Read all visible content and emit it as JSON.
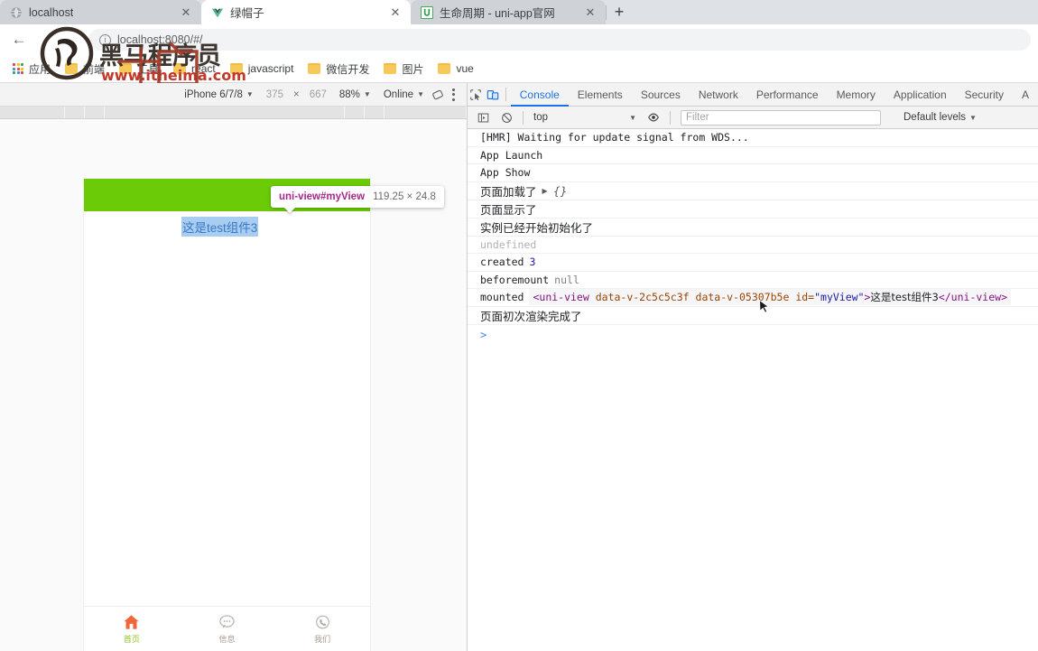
{
  "browser": {
    "tabs": [
      {
        "title": "localhost",
        "icon": "globe-icon",
        "active": false
      },
      {
        "title": "绿帽子",
        "icon": "vue-icon",
        "active": true
      },
      {
        "title": "生命周期 - uni-app官网",
        "icon": "uniapp-icon",
        "active": false
      }
    ],
    "new_tab_label": "+",
    "close_label": "✕",
    "back_label": "←",
    "address": {
      "url": "localhost:8080/#/",
      "info_icon": "page-info-icon",
      "info_glyph": "i"
    },
    "bookmarks": [
      {
        "label": "应用",
        "icon": "apps-grid-icon"
      },
      {
        "label": "前端",
        "icon": "folder-icon"
      },
      {
        "label": "工具",
        "icon": "folder-icon"
      },
      {
        "label": "react",
        "icon": "folder-icon"
      },
      {
        "label": "javascript",
        "icon": "folder-icon"
      },
      {
        "label": "微信开发",
        "icon": "folder-icon"
      },
      {
        "label": "图片",
        "icon": "folder-icon"
      },
      {
        "label": "vue",
        "icon": "folder-icon"
      }
    ],
    "watermark": {
      "title": "黑马程序员",
      "url": "www.itheima.com"
    }
  },
  "device_toolbar": {
    "device": "iPhone 6/7/8",
    "width": "375",
    "height": "667",
    "x_label": "×",
    "zoom": "88%",
    "throttling": "Online",
    "rotate_icon": "rotate-icon",
    "more_icon": "more-vertical-icon",
    "caret": "▼"
  },
  "viewport": {
    "highlight_badge": {
      "selector": "uni-view#myView",
      "size": "119.25 × 24.8"
    },
    "page_text": "这是test组件3",
    "green_bar_color": "#6bcb07",
    "tabbar": [
      {
        "label": "首页",
        "icon": "home-icon",
        "color": "#f1663a",
        "label_color": "#8ec31f"
      },
      {
        "label": "信息",
        "icon": "message-icon",
        "color": "#b4b0a9",
        "label_color": "#a89b8c"
      },
      {
        "label": "我们",
        "icon": "phone-icon",
        "color": "#b4b0a9",
        "label_color": "#a89b8c"
      }
    ]
  },
  "devtools": {
    "icons": {
      "inspect": "inspect-cursor-icon",
      "device": "device-toggle-icon",
      "sidebar": "console-sidebar-icon",
      "clear": "clear-console-icon",
      "eye": "live-expression-icon"
    },
    "panels": [
      {
        "label": "Console",
        "active": true
      },
      {
        "label": "Elements",
        "active": false
      },
      {
        "label": "Sources",
        "active": false
      },
      {
        "label": "Network",
        "active": false
      },
      {
        "label": "Performance",
        "active": false
      },
      {
        "label": "Memory",
        "active": false
      },
      {
        "label": "Application",
        "active": false
      },
      {
        "label": "Security",
        "active": false
      },
      {
        "label": "A",
        "active": false
      }
    ],
    "filterbar": {
      "context": "top",
      "filter_placeholder": "Filter",
      "levels": "Default levels",
      "caret": "▼"
    },
    "console_rows": [
      {
        "type": "plain",
        "text": "[HMR] Waiting for update signal from WDS..."
      },
      {
        "type": "plain",
        "text": "App Launch"
      },
      {
        "type": "plain",
        "text": "App Show"
      },
      {
        "type": "object",
        "text": "页面加载了",
        "arrow": "▶",
        "object": "{}"
      },
      {
        "type": "cjk",
        "text": "页面显示了"
      },
      {
        "type": "cjk",
        "text": "实例已经开始初始化了"
      },
      {
        "type": "muted",
        "text": "undefined"
      },
      {
        "type": "value",
        "text": "created",
        "value": "3"
      },
      {
        "type": "null",
        "text": "beforemount",
        "value": "null"
      },
      {
        "type": "element",
        "text": "mounted",
        "tag_open": "<uni-view",
        "attr1_name": "data-v-2c5c5c3f",
        "attr2_name": "data-v-05307b5e",
        "attr3_name": "id=",
        "attr3_value": "\"myView\"",
        "gt": ">",
        "inner": "这是test组件3",
        "tag_close": "</uni-view>"
      },
      {
        "type": "cjk",
        "text": "页面初次渲染完成了"
      }
    ],
    "prompt": ">"
  }
}
